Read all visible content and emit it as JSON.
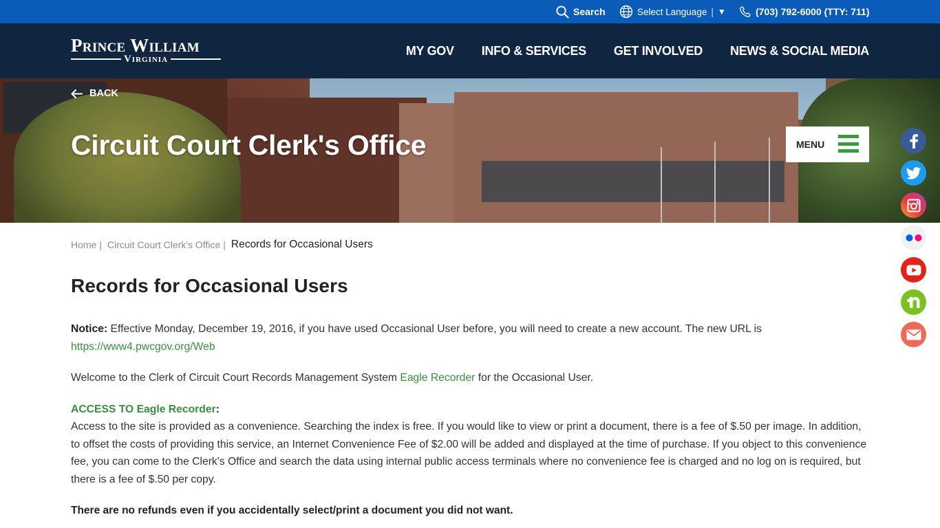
{
  "utility_bar": {
    "search_label": "Search",
    "language_label": "Select Language",
    "language_caret": "▼",
    "phone": "(703) 792-6000 (TTY: 711)"
  },
  "header": {
    "logo_top": "Prince William",
    "logo_bottom": "Virginia",
    "nav": [
      {
        "label": "MY GOV"
      },
      {
        "label": "INFO & SERVICES"
      },
      {
        "label": "GET INVOLVED"
      },
      {
        "label": "NEWS & SOCIAL MEDIA"
      }
    ]
  },
  "hero": {
    "back_label": "BACK",
    "title": "Circuit Court Clerk's Office",
    "menu_label": "MENU"
  },
  "social": [
    {
      "name": "facebook",
      "icon": "facebook-icon",
      "color": "#3b5a9a"
    },
    {
      "name": "twitter",
      "icon": "twitter-icon",
      "color": "#1d9bf0"
    },
    {
      "name": "instagram",
      "icon": "instagram-icon",
      "color": "#e5383b"
    },
    {
      "name": "flickr",
      "icon": "flickr-icon",
      "color": "#f1f2f4"
    },
    {
      "name": "youtube",
      "icon": "youtube-icon",
      "color": "#e2231a"
    },
    {
      "name": "nextdoor",
      "icon": "nextdoor-icon",
      "color": "#7ac21f"
    },
    {
      "name": "email",
      "icon": "email-icon",
      "color": "#ec6a57"
    }
  ],
  "breadcrumb": {
    "items": [
      {
        "label": "Home"
      },
      {
        "label": "Circuit Court Clerk's Office"
      }
    ],
    "current": "Records for Occasional Users",
    "separator": "|"
  },
  "page": {
    "title": "Records for Occasional Users",
    "notice_label": "Notice:",
    "notice_text": " Effective Monday, December 19, 2016, if you have used Occasional User before, you will need to create a new account. The new URL is ",
    "notice_url": "https://www4.pwcgov.org/Web",
    "welcome_before": "Welcome to the Clerk of Circuit Court Records Management System ",
    "welcome_link": "Eagle Recorder",
    "welcome_after": " for the Occasional User.",
    "access_heading": "ACCESS TO Eagle Recorder",
    "access_colon": ":",
    "access_text": "Access to the site is provided as a convenience. Searching the index is free. If you would like to view or print a document, there is a fee of $.50 per image. In addition, to offset the costs of providing this service, an Internet Convenience Fee of $2.00 will be added and displayed at the time of purchase. If you object to this convenience fee, you can come to the Clerk's Office and search the data using internal public access terminals where no convenience fee is charged and no log on is required, but there is a fee of $.50 per copy.",
    "refund_text": "There are no refunds even if you accidentally select/print a document you did not want."
  },
  "colors": {
    "utility_bar": "#0b5cb8",
    "header": "#10253f",
    "accent_green": "#3a8f3e"
  }
}
